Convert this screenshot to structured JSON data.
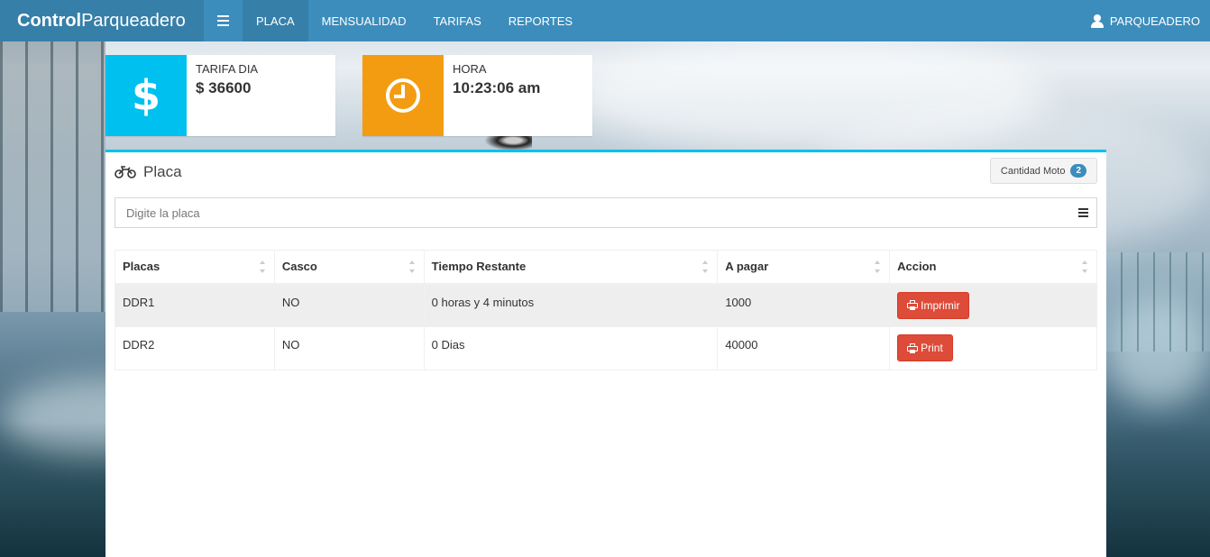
{
  "navbar": {
    "brand_bold": "Control",
    "brand_rest": "Parqueadero",
    "items": [
      {
        "label": "PLACA",
        "active": true
      },
      {
        "label": "MENSUALIDAD",
        "active": false
      },
      {
        "label": "TARIFAS",
        "active": false
      },
      {
        "label": "REPORTES",
        "active": false
      }
    ],
    "user": "PARQUEADERO"
  },
  "info_boxes": {
    "tarifa": {
      "label": "TARIFA DIA",
      "value": "$ 36600",
      "icon": "dollar-icon",
      "color": "#00c0ef"
    },
    "hora": {
      "label": "HORA",
      "value": "10:23:06 am",
      "icon": "clock-icon",
      "color": "#f39c12"
    }
  },
  "panel": {
    "title": "Placa",
    "title_icon": "motorcycle-icon",
    "count_label": "Cantidad Moto",
    "count_value": "2",
    "search_placeholder": "Digite la placa"
  },
  "table": {
    "headers": [
      "Placas",
      "Casco",
      "Tiempo Restante",
      "A pagar",
      "Accion"
    ],
    "rows": [
      {
        "placa": "DDR1",
        "casco": "NO",
        "tiempo": "0 horas y 4 minutos",
        "pagar": "1000",
        "action": "Imprimir"
      },
      {
        "placa": "DDR2",
        "casco": "NO",
        "tiempo": "0 Dias",
        "pagar": "40000",
        "action": "Print"
      }
    ]
  },
  "colors": {
    "primary": "#3c8dbc",
    "primary_dark": "#367fa9",
    "danger": "#dd4b39"
  }
}
